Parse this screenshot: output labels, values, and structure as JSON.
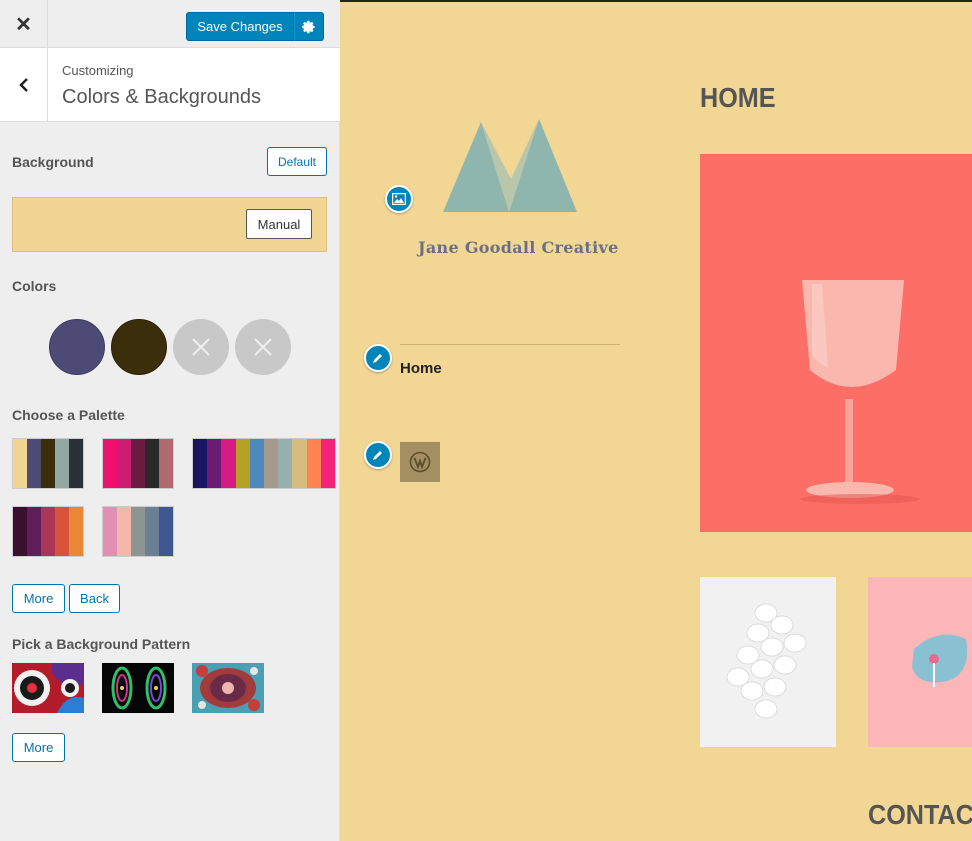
{
  "topbar": {
    "close_icon": "close-icon",
    "save_label": "Save Changes",
    "settings_icon": "gear-icon"
  },
  "header": {
    "crumb": "Customizing",
    "title": "Colors & Backgrounds"
  },
  "background": {
    "label": "Background",
    "default_label": "Default",
    "manual_label": "Manual",
    "color": "#f1d592"
  },
  "colors": {
    "label": "Colors",
    "swatches": [
      "#4d4a75",
      "#3a2e0b",
      "#c8c8c8",
      "#c8c8c8"
    ]
  },
  "palette": {
    "label": "Choose a Palette",
    "rows": [
      [
        "#f1d592",
        "#4d4a75",
        "#3a2e0b",
        "#91a8a5",
        "#2b3036"
      ],
      [
        "#ee0f6f",
        "#ce1b73",
        "#6d1a43",
        "#292929",
        "#b06a6f"
      ],
      [
        "#1b1462",
        "#6c1b74",
        "#d61b83",
        "#b3a223",
        "#4e88bd",
        "#a69a8c",
        "#95b0af",
        "#d3bc7c",
        "#ff8452",
        "#f4227a"
      ],
      [
        "#3b0f2e",
        "#5f1e57",
        "#a93659",
        "#d8533c",
        "#ea8734"
      ],
      [
        "#e28fb3",
        "#f6b6aa",
        "#8c9494",
        "#6c7f94",
        "#3f5893"
      ]
    ]
  },
  "buttons": {
    "more": "More",
    "back": "Back"
  },
  "patterns": {
    "label": "Pick a Background Pattern",
    "more": "More"
  },
  "preview": {
    "site_name": "Jane Goodall Creative",
    "menu_item": "Home",
    "page_heading": "HOME",
    "contact_heading": "CONTACT",
    "logo_color": "#8fb6ae"
  }
}
